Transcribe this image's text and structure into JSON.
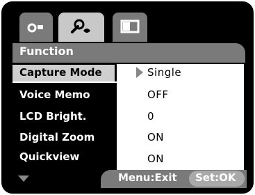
{
  "tabs": [
    {
      "name": "camera",
      "icon": "camera-icon"
    },
    {
      "name": "function",
      "icon": "wrench-icon",
      "active": true
    },
    {
      "name": "display",
      "icon": "display-icon"
    }
  ],
  "title": "Function",
  "rows": [
    {
      "label": "Capture Mode",
      "value": "Single"
    },
    {
      "label": "Voice Memo",
      "value": "OFF"
    },
    {
      "label": "LCD Bright.",
      "value": "0"
    },
    {
      "label": "Digital Zoom",
      "value": "ON"
    },
    {
      "label": "Quickview",
      "value": "ON"
    }
  ],
  "footer": {
    "menu": "Menu:Exit",
    "set": "Set:OK"
  },
  "colors": {
    "background": "#000000",
    "tab_active": "#c8c8c8",
    "tab_inactive": "#7a7a7a",
    "value_bg": "#ffffff"
  }
}
